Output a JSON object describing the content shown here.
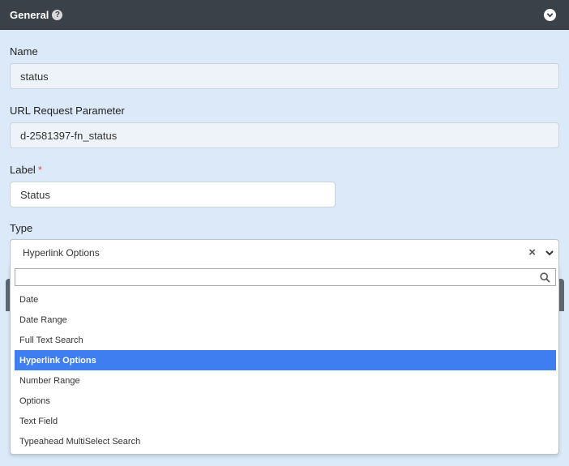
{
  "panel": {
    "title": "General",
    "help_icon": "question-circle-icon",
    "collapse_icon": "chevron-circle-down-icon"
  },
  "fields": {
    "name": {
      "label": "Name",
      "value": "status"
    },
    "url_param": {
      "label": "URL Request Parameter",
      "value": "d-2581397-fn_status"
    },
    "label": {
      "label": "Label",
      "required_mark": "*",
      "value": "Status"
    },
    "type": {
      "label": "Type",
      "selected": "Hyperlink Options",
      "clear_icon": "close-icon",
      "chevron_icon": "chevron-down-icon"
    }
  },
  "dropdown": {
    "search_value": "",
    "search_icon": "search-icon",
    "options": [
      "Date",
      "Date Range",
      "Full Text Search",
      "Hyperlink Options",
      "Number Range",
      "Options",
      "Text Field",
      "Typeahead MultiSelect Search"
    ],
    "selected_index": 3
  },
  "colors": {
    "header_bg": "#3b4149",
    "body_bg": "#dbe9f8",
    "selected_bg": "#3e7ef0",
    "required": "#d9534f"
  }
}
